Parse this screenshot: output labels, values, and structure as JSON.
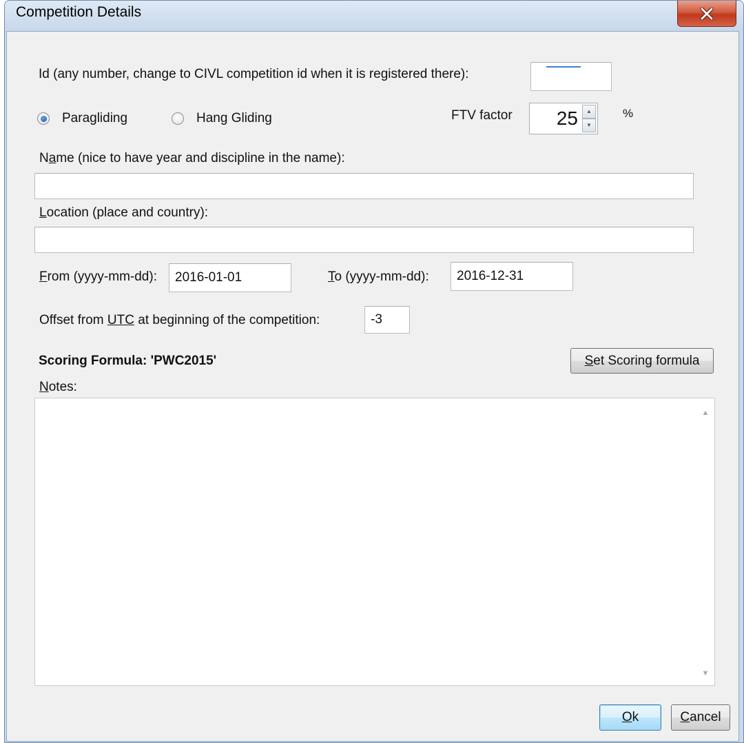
{
  "window": {
    "title": "Competition Details"
  },
  "id_field": {
    "label": "Id (any number, change to CIVL competition id when it is registered there):",
    "value": ""
  },
  "glider_type": {
    "options": [
      {
        "label": "Paragliding",
        "selected": true
      },
      {
        "label": "Hang Gliding",
        "selected": false
      }
    ]
  },
  "ftv": {
    "label": "FTV factor",
    "value": "25",
    "unit": "%"
  },
  "name_field": {
    "label_accel": "a",
    "label_pre": "N",
    "label_post": "me (nice to have year and discipline in the name):",
    "value": ""
  },
  "location_field": {
    "label_accel": "L",
    "label_post": "ocation (place and country):",
    "value": ""
  },
  "from_field": {
    "label_accel": "F",
    "label_post": "rom (yyyy-mm-dd):",
    "value": "2016-01-01"
  },
  "to_field": {
    "label_accel": "T",
    "label_post": "o (yyyy-mm-dd):",
    "value": "2016-12-31"
  },
  "utc_offset": {
    "label_pre": "Offset from ",
    "label_accel": "UTC",
    "label_post": " at beginning of the competition:",
    "value": "-3"
  },
  "scoring": {
    "label": "Scoring Formula: 'PWC2015'",
    "button_accel": "S",
    "button_post": "et Scoring formula"
  },
  "notes": {
    "label_accel": "N",
    "label_post": "otes:",
    "value": ""
  },
  "buttons": {
    "ok_accel": "O",
    "ok_post": "k",
    "cancel_accel": "C",
    "cancel_post": "ancel"
  },
  "colors": {
    "title_bar": "#c6d7eb",
    "close_button": "#c0391e",
    "dialog_background": "#f0f0f0",
    "default_button": "#a7d9f5"
  }
}
